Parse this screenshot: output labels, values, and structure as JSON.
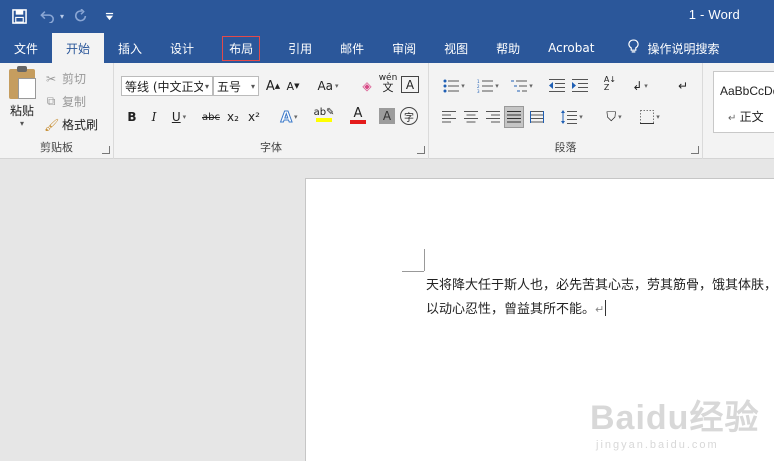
{
  "title_bar": {
    "document_title": "1 - Word",
    "quick_access": [
      {
        "name": "save-icon",
        "glyph": "💾"
      },
      {
        "name": "undo-icon",
        "glyph": "↶"
      },
      {
        "name": "redo-icon",
        "glyph": "↻"
      },
      {
        "name": "customize-qat-icon",
        "glyph": "▾"
      }
    ],
    "background": "#2b579a"
  },
  "tabs": [
    {
      "label": "文件"
    },
    {
      "label": "开始",
      "active": true
    },
    {
      "label": "插入"
    },
    {
      "label": "设计"
    },
    {
      "label": "布局",
      "highlighted": true
    },
    {
      "label": "引用"
    },
    {
      "label": "邮件"
    },
    {
      "label": "审阅"
    },
    {
      "label": "视图"
    },
    {
      "label": "帮助"
    },
    {
      "label": "Acrobat"
    }
  ],
  "tell_me": {
    "label": "操作说明搜索",
    "icon": "lightbulb-icon"
  },
  "ribbon": {
    "clipboard": {
      "label": "剪贴板",
      "paste": "粘贴",
      "cut": "剪切",
      "copy": "复制",
      "format_painter": "格式刷"
    },
    "font": {
      "label": "字体",
      "font_name": "等线 (中文正文)",
      "font_size": "五号",
      "change_case": "Aa",
      "phonetic": "wén",
      "bold": "B",
      "italic": "I",
      "underline": "U",
      "strike": "abc",
      "subscript": "x₂",
      "superscript": "x²",
      "font_color_letter": "A",
      "font_color": "#e41b1b",
      "highlight_color": "#ffff00",
      "char_shading": "A",
      "enclose": "字"
    },
    "paragraph": {
      "label": "段落"
    },
    "styles": {
      "sample": "AaBbCcDd",
      "name": "正文"
    }
  },
  "document": {
    "paragraph_line1": "天将降大任于斯人也，必先苦其心志，劳其筋骨，饿其体肤，",
    "paragraph_line2": "以动心忍性，曾益其所不能。",
    "paragraph_mark": "↵"
  },
  "watermark": {
    "text": "Baidu经验",
    "url": "jingyan.baidu.com"
  }
}
